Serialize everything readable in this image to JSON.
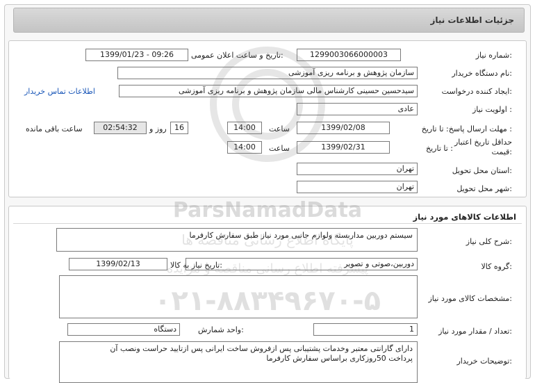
{
  "header": {
    "title": "جزئیات اطلاعات نیاز"
  },
  "need_info": {
    "need_number_label": "شماره نیاز:",
    "need_number": "1299003066000003",
    "announce_label": "تاریخ و ساعت اعلان عمومی:",
    "announce_value": "1399/01/23 - 09:26",
    "buyer_org_label": "نام دستگاه خریدار:",
    "buyer_org": "سازمان پژوهش و برنامه ریزی آموزشی",
    "requester_label": "ایجاد کننده درخواست:",
    "requester": "سیدحسین حسینی کارشناس مالی سازمان پژوهش و برنامه ریزی آموزشی",
    "contact_link": "اطلاعات تماس خریدار",
    "priority_label": "اولویت نیاز :",
    "priority": "عادی",
    "reply_deadline_label": "مهلت ارسال پاسخ: تا تاریخ :",
    "reply_date": "1399/02/08",
    "time_label": "ساعت",
    "reply_time": "14:00",
    "days_value": "16",
    "days_and_label": "روز و",
    "remaining_time": "02:54:32",
    "remaining_label": "ساعت باقی مانده",
    "validity_label_1": "حداقل تاریخ اعتبار",
    "validity_label_2": "قیمت:",
    "validity_to_label": "تا تاریخ :",
    "validity_date": "1399/02/31",
    "validity_time_label": "ساعت",
    "validity_time": "14:00",
    "province_label": "استان محل تحویل:",
    "province": "تهران",
    "city_label": "شهر محل تحویل:",
    "city": "تهران"
  },
  "goods": {
    "section_title": "اطلاعات کالاهای مورد نیاز",
    "general_desc_label": "شرح کلی نیاز:",
    "general_desc": "سیستم دوربین مداربسته ولوازم جانبی مورد نیاز طبق سفارش کارفرما",
    "goods_group_label": "گروه کالا:",
    "goods_group": "دوربین،صوتی و تصویر",
    "need_date_label": "تاریخ نیاز به کالا:",
    "need_date": "1399/02/13",
    "specs_label": "مشخصات کالای مورد نیاز:",
    "specs": "",
    "qty_label": "تعداد / مقدار مورد نیاز:",
    "qty": "1",
    "unit_label": "واحد شمارش:",
    "unit": "دستگاه",
    "buyer_notes_label": "توضیحات خریدار:",
    "buyer_notes_line1": "دارای گارانتی معتبر وخدمات پشتیبانی پس ازفروش ساخت ایرانی پس ازتایید حراست ونصب آن",
    "buyer_notes_line2": "پرداخت 50روزکاری براساس سفارش کارفرما"
  },
  "watermark": {
    "brand": "ParsNamadData",
    "line1": "پایگاه اطلاع رسانی مناقصه ها",
    "line2": "پیشرفته اطلاع رسانی مناقصه و مزایده",
    "phone": "۰۲۱-۸۸۳۴۹۶۷۰-۵"
  },
  "colors": {
    "header_bg": "#cfcfcf",
    "link": "#1a57b8",
    "gray_box": "#e6e6e6"
  }
}
